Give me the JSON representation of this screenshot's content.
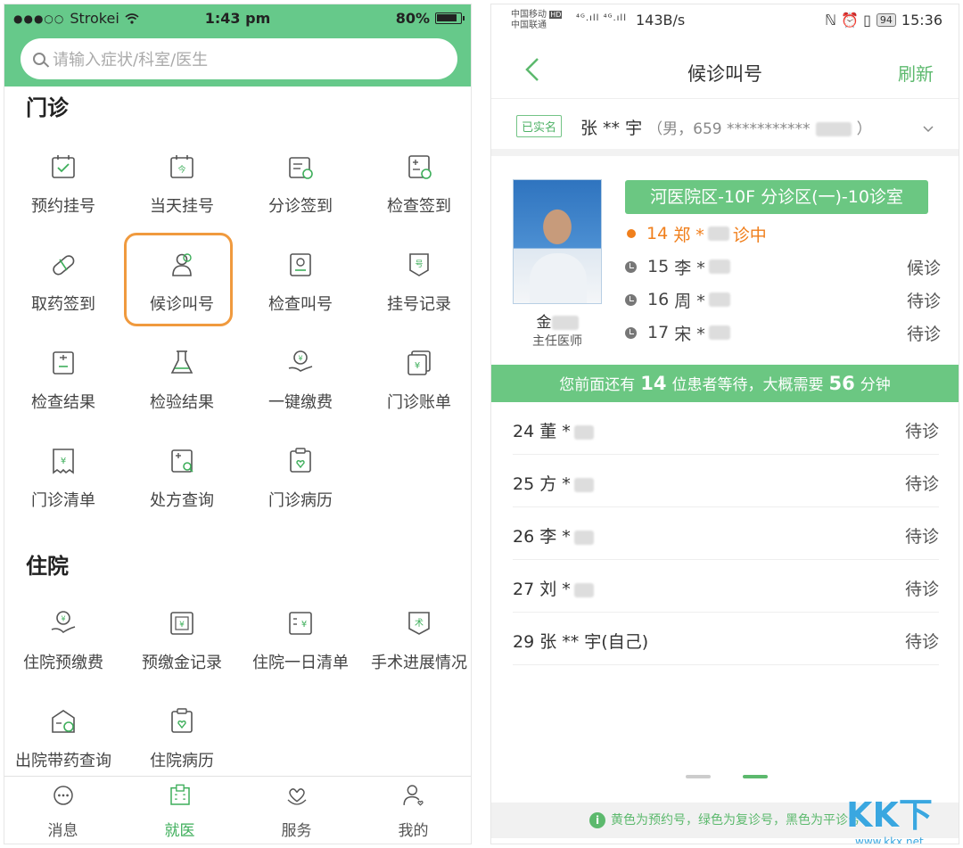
{
  "left_screen": {
    "status": {
      "dots": "●●●○○",
      "carrier": "Strokei",
      "time": "1:43 pm",
      "battery": "80%"
    },
    "search": {
      "placeholder": "请输入症状/科室/医生"
    },
    "outpatient": {
      "title": "门诊",
      "items": [
        {
          "label": "预约挂号",
          "icon": "calendar-check-icon"
        },
        {
          "label": "当天挂号",
          "icon": "calendar-today-icon"
        },
        {
          "label": "分诊签到",
          "icon": "triage-checkin-icon"
        },
        {
          "label": "检查签到",
          "icon": "exam-checkin-icon"
        },
        {
          "label": "取药签到",
          "icon": "pill-icon"
        },
        {
          "label": "候诊叫号",
          "icon": "queue-person-icon"
        },
        {
          "label": "检查叫号",
          "icon": "exam-call-icon"
        },
        {
          "label": "挂号记录",
          "icon": "register-record-icon"
        },
        {
          "label": "检查结果",
          "icon": "exam-result-icon"
        },
        {
          "label": "检验结果",
          "icon": "flask-icon"
        },
        {
          "label": "一键缴费",
          "icon": "pay-hand-icon"
        },
        {
          "label": "门诊账单",
          "icon": "bill-icon"
        },
        {
          "label": "门诊清单",
          "icon": "receipt-icon"
        },
        {
          "label": "处方查询",
          "icon": "prescription-search-icon"
        },
        {
          "label": "门诊病历",
          "icon": "medical-record-icon"
        }
      ]
    },
    "inpatient": {
      "title": "住院",
      "items": [
        {
          "label": "住院预缴费",
          "icon": "prepay-icon"
        },
        {
          "label": "预缴金记录",
          "icon": "deposit-record-icon"
        },
        {
          "label": "住院一日清单",
          "icon": "daily-list-icon"
        },
        {
          "label": "手术进展情况",
          "icon": "surgery-icon"
        },
        {
          "label": "出院带药查询",
          "icon": "discharge-medicine-icon"
        },
        {
          "label": "住院病历",
          "icon": "inpatient-record-icon"
        }
      ]
    },
    "tabbar": [
      {
        "label": "消息",
        "icon": "message-icon",
        "active": false
      },
      {
        "label": "就医",
        "icon": "hospital-icon",
        "active": true
      },
      {
        "label": "服务",
        "icon": "heart-hands-icon",
        "active": false
      },
      {
        "label": "我的",
        "icon": "user-icon",
        "active": false
      }
    ]
  },
  "right_screen": {
    "status": {
      "carrier1": "中国移动",
      "carrier2": "中国联通",
      "hd_badge": "HD",
      "network": "⁴ᴳ.ıll ⁴ᴳ.ıll",
      "speed": "143B/s",
      "right_icons": "ℕ ⏰ ▯ ",
      "battery": "94",
      "time": "15:36"
    },
    "nav": {
      "title": "候诊叫号",
      "refresh": "刷新"
    },
    "patient": {
      "verified": "已实名",
      "name": "张 ** 宇",
      "sub_prefix": "（男，659 ***********",
      "sub_suffix": "）"
    },
    "doctor": {
      "name": "金",
      "title": "主任医师"
    },
    "room": "河医院区-10F 分诊区(一)-10诊室",
    "queue": [
      {
        "number": "14",
        "name": "郑 *",
        "status": "诊中",
        "current": true
      },
      {
        "number": "15",
        "name": "李 *",
        "status": "候诊",
        "current": false
      },
      {
        "number": "16",
        "name": "周 *",
        "status": "待诊",
        "current": false
      },
      {
        "number": "17",
        "name": "宋 *",
        "status": "待诊",
        "current": false
      }
    ],
    "wait": {
      "prefix": "您前面还有",
      "people": "14",
      "mid": "位患者等待，大概需要",
      "minutes": "56",
      "suffix": "分钟"
    },
    "list": [
      {
        "name": "24 董 *",
        "status": "待诊"
      },
      {
        "name": "25 方 *",
        "status": "待诊"
      },
      {
        "name": "26 李 *",
        "status": "待诊"
      },
      {
        "name": "27 刘 *",
        "status": "待诊"
      },
      {
        "name": "29 张 ** 宇(自己)",
        "status": "待诊"
      }
    ],
    "legend": "黄色为预约号，绿色为复诊号，黑色为平诊号",
    "legend_info": "i",
    "watermark": {
      "text": "KK下载",
      "url": "www.kkx.net"
    }
  },
  "colors": {
    "green": "#66c98a",
    "accent_orange": "#f07f1c",
    "highlight_border": "#f09a3e"
  }
}
